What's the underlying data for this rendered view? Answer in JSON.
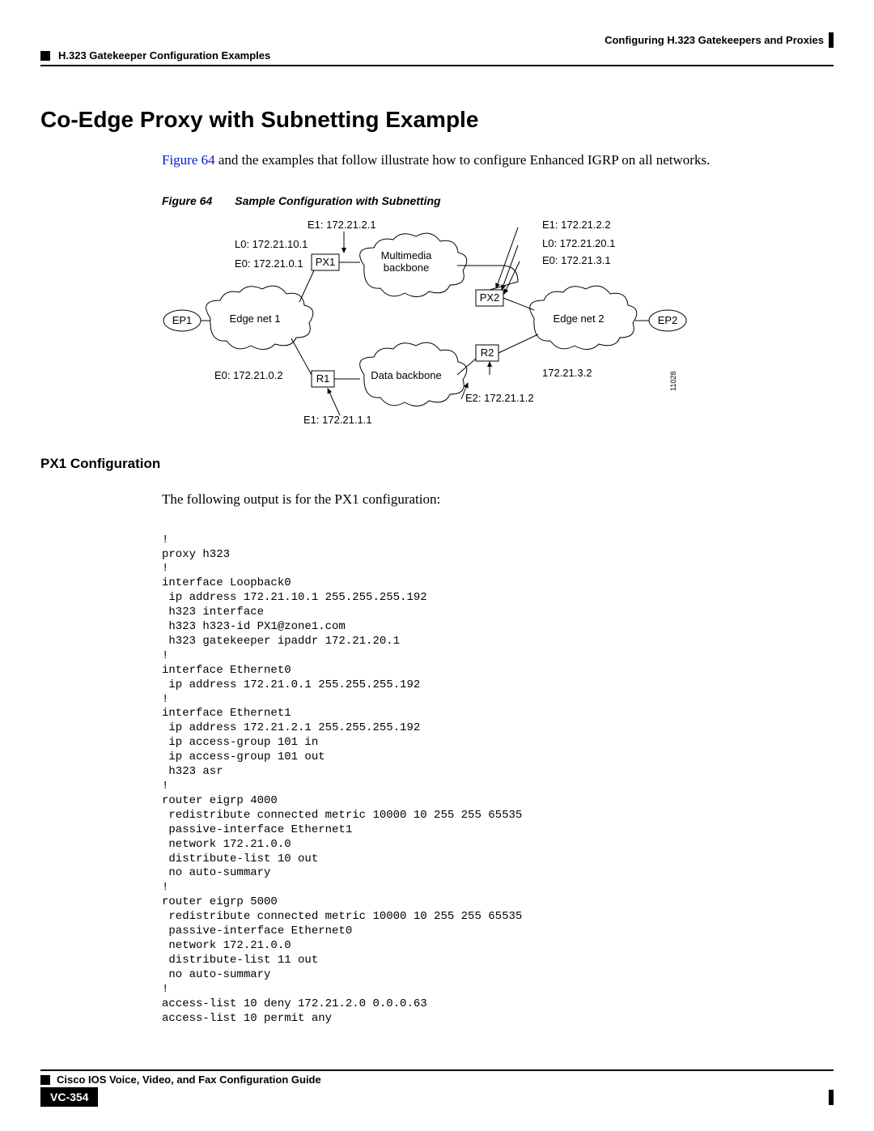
{
  "header": {
    "chapter": "Configuring H.323 Gatekeepers and Proxies",
    "section": "H.323 Gatekeeper Configuration Examples"
  },
  "title": "Co-Edge Proxy with Subnetting Example",
  "intro_link": "Figure 64",
  "intro_rest": " and the examples that follow illustrate how to configure Enhanced IGRP on all networks.",
  "figure": {
    "label": "Figure 64",
    "caption": "Sample Configuration with Subnetting",
    "id": "11028",
    "labels": {
      "e1_px1": "E1:  172.21.2.1",
      "l0_px1": "L0:  172.21.10.1",
      "e0_px1": "E0:  172.21.0.1",
      "e1_px2": "E1:  172.21.2.2",
      "l0_px2": "L0:  172.21.20.1",
      "e0_px2": "E0:  172.21.3.1",
      "ep1": "EP1",
      "ep2": "EP2",
      "px1": "PX1",
      "px2": "PX2",
      "r1": "R1",
      "r2": "R2",
      "edge1": "Edge net 1",
      "edge2": "Edge net 2",
      "mmbb": "Multimedia",
      "mmbb2": "backbone",
      "databb": "Data backbone",
      "e0_r1": "E0:  172.21.0.2",
      "e1_r1": "E1:  172.21.1.1",
      "e2_r2": "E2:  172.21.1.2",
      "ip_r2": "172.21.3.2"
    }
  },
  "px1_heading": "PX1 Configuration",
  "px1_intro": "The following output is for the PX1 configuration:",
  "px1_code": "!\nproxy h323\n!\ninterface Loopback0\n ip address 172.21.10.1 255.255.255.192\n h323 interface\n h323 h323-id PX1@zone1.com\n h323 gatekeeper ipaddr 172.21.20.1\n!\ninterface Ethernet0\n ip address 172.21.0.1 255.255.255.192\n!\ninterface Ethernet1\n ip address 172.21.2.1 255.255.255.192\n ip access-group 101 in\n ip access-group 101 out\n h323 asr\n!\nrouter eigrp 4000\n redistribute connected metric 10000 10 255 255 65535\n passive-interface Ethernet1\n network 172.21.0.0\n distribute-list 10 out\n no auto-summary\n!\nrouter eigrp 5000\n redistribute connected metric 10000 10 255 255 65535\n passive-interface Ethernet0\n network 172.21.0.0\n distribute-list 11 out\n no auto-summary\n!\naccess-list 10 deny 172.21.2.0 0.0.0.63\naccess-list 10 permit any",
  "footer": {
    "guide": "Cisco IOS Voice, Video, and Fax Configuration Guide",
    "page": "VC-354"
  }
}
